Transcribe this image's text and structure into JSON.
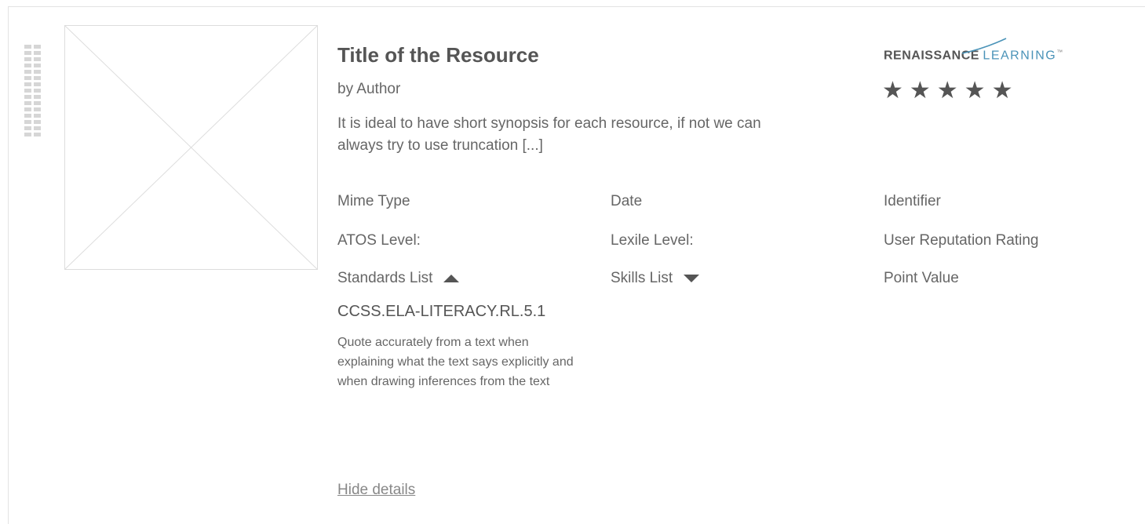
{
  "resource": {
    "title": "Title of the Resource",
    "author": "by Author",
    "synopsis": "It is ideal to have short synopsis for each resource, if not we can always try to use truncation [...]"
  },
  "brand": {
    "name_bold": "RENAISSANCE",
    "name_light": "LEARNING",
    "trademark": "™",
    "accent_color": "#4a93b8"
  },
  "rating": {
    "stars": 5,
    "glyphs": "★★★★★"
  },
  "fields": {
    "mime_type": "Mime Type",
    "date": "Date",
    "identifier": "Identifier",
    "atos_level": "ATOS Level:",
    "lexile_level": "Lexile Level:",
    "user_reputation": "User Reputation Rating",
    "standards_list": "Standards List",
    "skills_list": "Skills List",
    "point_value": "Point Value"
  },
  "standard": {
    "code": "CCSS.ELA-LITERACY.RL.5.1",
    "description": "Quote accurately from a text when explaining what the text says explicitly and when drawing inferences from the text"
  },
  "actions": {
    "hide_details": "Hide details"
  },
  "icons": {
    "drag_handle": "drag-handle-icon",
    "thumbnail": "image-placeholder-icon",
    "standards_toggle": "caret-up-icon",
    "skills_toggle": "caret-down-icon"
  }
}
